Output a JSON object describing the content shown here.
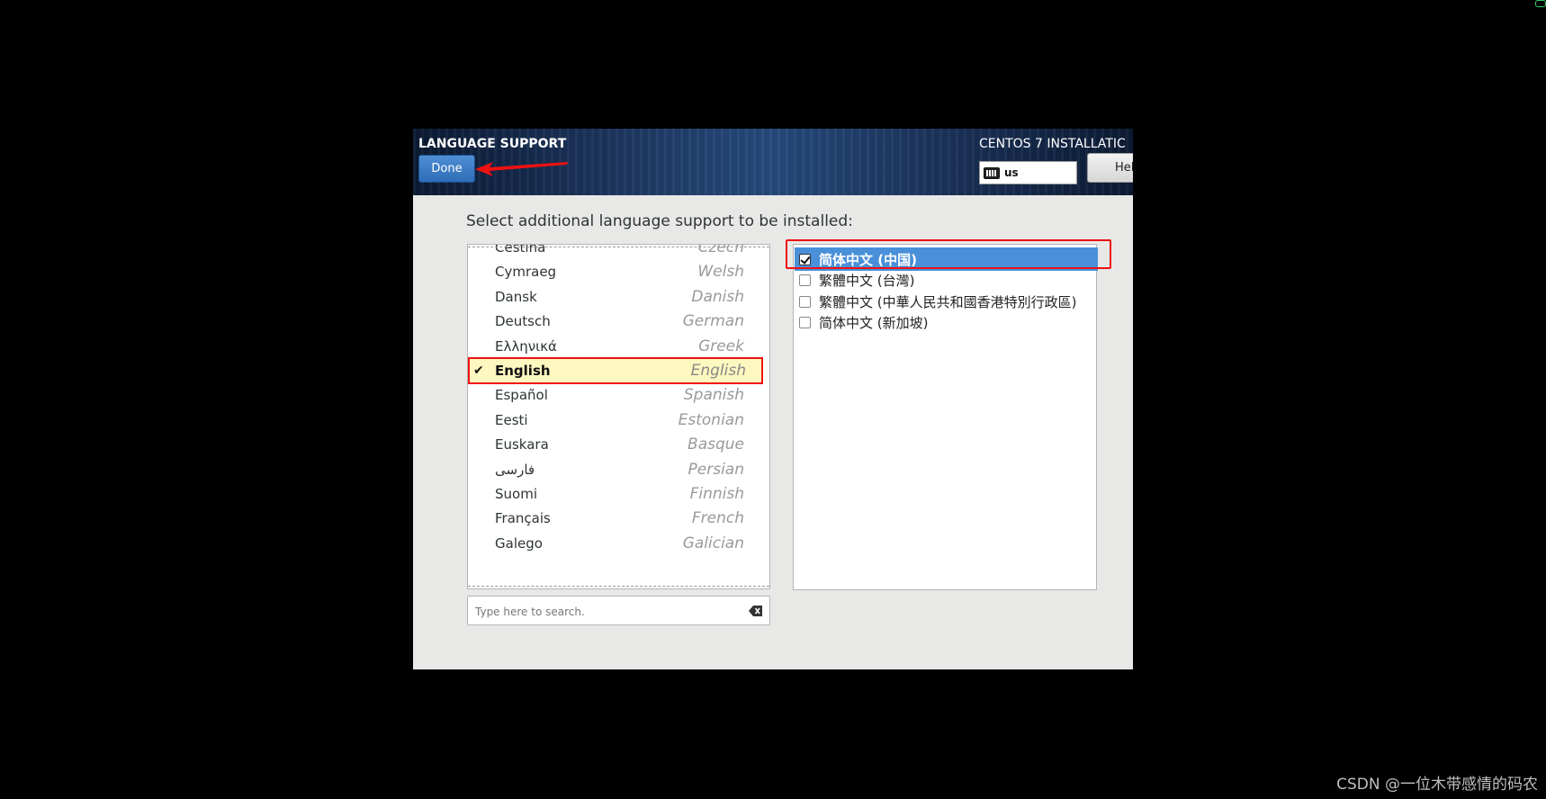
{
  "header": {
    "spoke_title": "LANGUAGE SUPPORT",
    "done_label": "Done",
    "product_title": "CENTOS 7 INSTALLATIC",
    "keyboard_layout": "us",
    "help_label": "Help!"
  },
  "prompt": "Select additional language support to be installed:",
  "languages": [
    {
      "native": "Čeština",
      "english": "Czech",
      "selected": false
    },
    {
      "native": "Cymraeg",
      "english": "Welsh",
      "selected": false
    },
    {
      "native": "Dansk",
      "english": "Danish",
      "selected": false
    },
    {
      "native": "Deutsch",
      "english": "German",
      "selected": false
    },
    {
      "native": "Ελληνικά",
      "english": "Greek",
      "selected": false
    },
    {
      "native": "English",
      "english": "English",
      "selected": true
    },
    {
      "native": "Español",
      "english": "Spanish",
      "selected": false
    },
    {
      "native": "Eesti",
      "english": "Estonian",
      "selected": false
    },
    {
      "native": "Euskara",
      "english": "Basque",
      "selected": false
    },
    {
      "native": "فارسی",
      "english": "Persian",
      "selected": false
    },
    {
      "native": "Suomi",
      "english": "Finnish",
      "selected": false
    },
    {
      "native": "Français",
      "english": "French",
      "selected": false
    },
    {
      "native": "Galego",
      "english": "Galician",
      "selected": false
    }
  ],
  "locales": [
    {
      "label": "简体中文 (中国)",
      "checked": true
    },
    {
      "label": "繁體中文 (台灣)",
      "checked": false
    },
    {
      "label": "繁體中文 (中華人民共和國香港特別行政區)",
      "checked": false
    },
    {
      "label": "简体中文 (新加坡)",
      "checked": false
    }
  ],
  "search": {
    "placeholder": "Type here to search."
  },
  "watermark": "CSDN @一位木带感情的码农",
  "colors": {
    "accent": "#4a90d9",
    "highlight_border": "#ee1111",
    "selected_row": "#fdf8c0"
  }
}
